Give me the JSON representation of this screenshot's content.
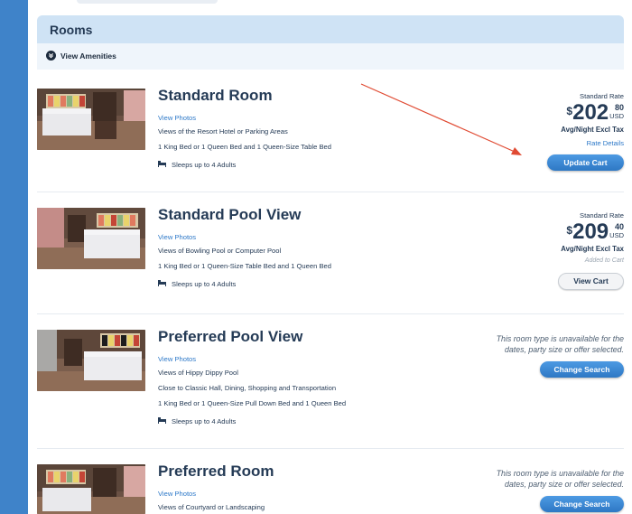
{
  "section": {
    "title": "Rooms",
    "amenities_label": "View Amenities"
  },
  "rooms": [
    {
      "name": "Standard Room",
      "view_photos": "View Photos",
      "details": [
        "Views of the Resort Hotel or Parking Areas",
        "1 King Bed or 1 Queen Bed and 1 Queen-Size Table Bed"
      ],
      "sleeps": "Sleeps up to 4 Adults",
      "rate_label": "Standard Rate",
      "price_dollars": "202",
      "price_cents": "80",
      "currency": "USD",
      "per_night": "Avg/Night Excl Tax",
      "rate_details": "Rate Details",
      "button": "Update Cart"
    },
    {
      "name": "Standard Pool View",
      "view_photos": "View Photos",
      "details": [
        "Views of Bowling Pool or Computer Pool",
        "1 King Bed or 1 Queen-Size Table Bed and 1 Queen Bed"
      ],
      "sleeps": "Sleeps up to 4 Adults",
      "rate_label": "Standard Rate",
      "price_dollars": "209",
      "price_cents": "40",
      "currency": "USD",
      "per_night": "Avg/Night Excl Tax",
      "added_note": "Added to Cart",
      "button": "View Cart"
    },
    {
      "name": "Preferred Pool View",
      "view_photos": "View Photos",
      "details": [
        "Views of Hippy Dippy Pool",
        "Close to Classic Hall, Dining, Shopping and Transportation",
        "1 King Bed or 1 Queen-Size Pull Down Bed and 1 Queen Bed"
      ],
      "sleeps": "Sleeps up to 4 Adults",
      "unavailable": [
        "This room type is unavailable for the",
        "dates, party size or offer selected."
      ],
      "button": "Change Search"
    },
    {
      "name": "Preferred Room",
      "view_photos": "View Photos",
      "details": [
        "Views of Courtyard or Landscaping"
      ],
      "unavailable": [
        "This room type is unavailable for the",
        "dates, party size or offer selected."
      ],
      "button": "Change Search"
    }
  ],
  "colors": {
    "accent": "#2e78c4",
    "annotation_arrow": "#e04a32",
    "header_bg": "#cfe3f5"
  }
}
